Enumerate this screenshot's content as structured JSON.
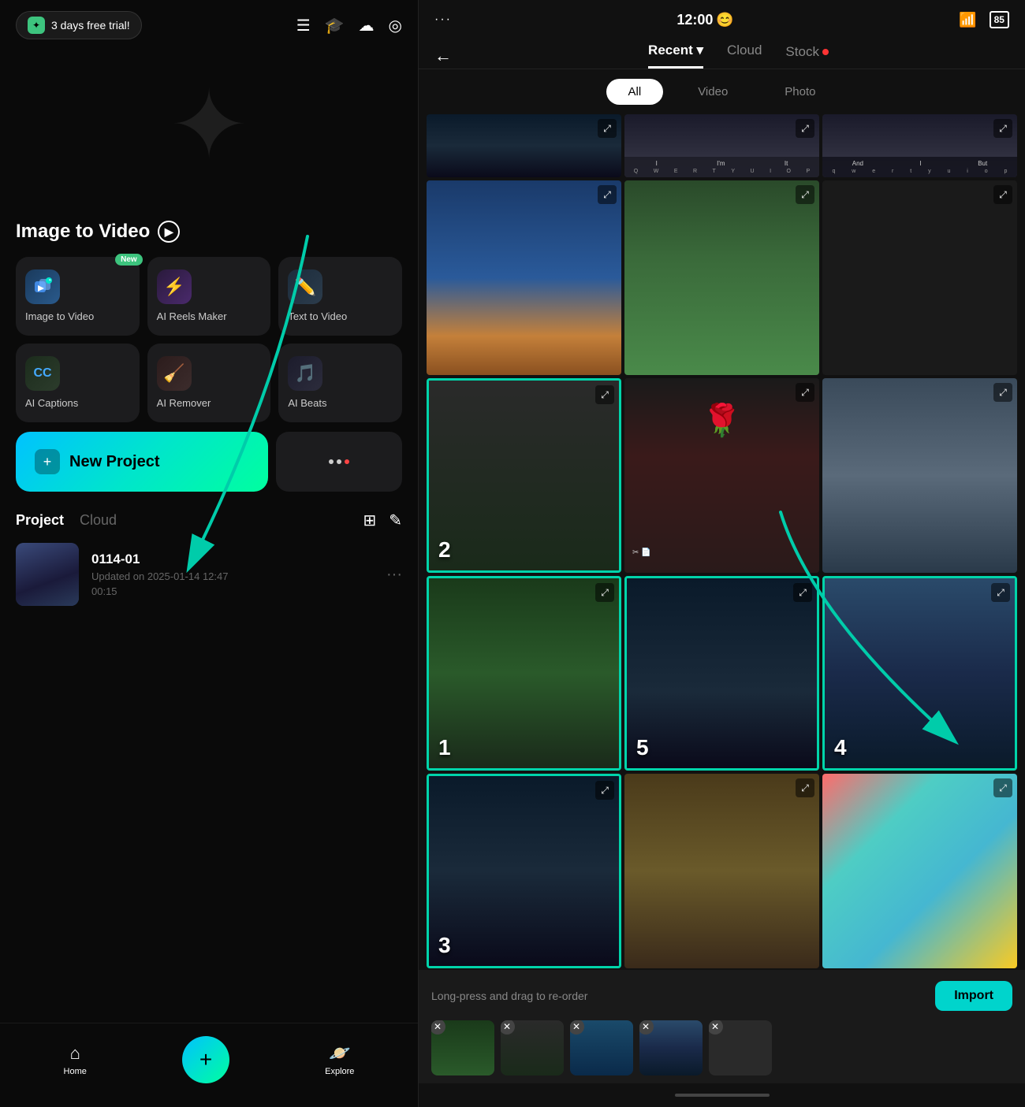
{
  "status": {
    "time": "12:00",
    "emoji": "😊",
    "battery": "85",
    "wifi": "WiFi"
  },
  "left": {
    "trial_badge": "3 days free trial!",
    "itv_title": "Image to Video",
    "features": [
      {
        "id": "image-to-video",
        "label": "Image to Video",
        "icon": "🎬",
        "iconBg": "icon-itv",
        "isNew": true
      },
      {
        "id": "ai-reels",
        "label": "AI Reels Maker",
        "icon": "⚡",
        "iconBg": "icon-reels",
        "isNew": false
      },
      {
        "id": "text-to-video",
        "label": "Text  to Video",
        "icon": "✏️",
        "iconBg": "icon-ttv",
        "isNew": false
      },
      {
        "id": "ai-captions",
        "label": "AI Captions",
        "icon": "CC",
        "iconBg": "icon-captions",
        "isNew": false
      },
      {
        "id": "ai-remover",
        "label": "AI Remover",
        "icon": "🧹",
        "iconBg": "icon-remover",
        "isNew": false
      },
      {
        "id": "ai-beats",
        "label": "AI Beats",
        "icon": "🎵",
        "iconBg": "icon-beats",
        "isNew": false
      }
    ],
    "new_project_label": "+ New Project",
    "new_project_btn": "New Project",
    "project_tab": "Project",
    "cloud_tab": "Cloud",
    "project_name": "0114-01",
    "project_date": "Updated on 2025-01-14 12:47",
    "project_duration": "00:15",
    "nav": {
      "home": "Home",
      "explore": "Explore"
    }
  },
  "right": {
    "back": "←",
    "tabs": [
      "Recent",
      "Cloud",
      "Stock"
    ],
    "active_tab": "Recent",
    "dropdown_arrow": "▾",
    "filter_tabs": [
      "All",
      "Video",
      "Photo"
    ],
    "active_filter": "All",
    "media_cells": [
      {
        "id": "c1",
        "bg": "bg-keyboard",
        "selected": false,
        "number": null
      },
      {
        "id": "c2",
        "bg": "bg-tree",
        "selected": false,
        "number": null
      },
      {
        "id": "c3",
        "bg": "bg-dark",
        "selected": false,
        "number": null
      },
      {
        "id": "c4",
        "bg": "bg-laptop",
        "selected": false,
        "number": null
      },
      {
        "id": "c5",
        "bg": "bg-food",
        "selected": false,
        "number": null
      },
      {
        "id": "c6",
        "bg": "bg-dark2",
        "selected": false,
        "number": null
      },
      {
        "id": "c7",
        "bg": "bg-dark2",
        "selected": true,
        "number": "2"
      },
      {
        "id": "c8",
        "bg": "bg-rose",
        "selected": false,
        "number": null
      },
      {
        "id": "c9",
        "bg": "bg-window",
        "selected": false,
        "number": null
      },
      {
        "id": "c10",
        "bg": "bg-landscape",
        "selected": true,
        "number": "1"
      },
      {
        "id": "c11",
        "bg": "bg-night",
        "selected": true,
        "number": "5"
      },
      {
        "id": "c12",
        "bg": "bg-mountain",
        "selected": true,
        "number": "4"
      },
      {
        "id": "c13",
        "bg": "bg-street",
        "selected": true,
        "number": "3"
      },
      {
        "id": "c14",
        "bg": "bg-pizza",
        "selected": false,
        "number": null
      },
      {
        "id": "c15",
        "bg": "bg-colorful",
        "selected": false,
        "number": null
      }
    ],
    "import_hint": "Long-press and drag to re-order",
    "import_btn": "Import",
    "strip_items": [
      {
        "id": "s1",
        "bg": "bg-landscape"
      },
      {
        "id": "s2",
        "bg": "bg-dark2"
      },
      {
        "id": "s3",
        "bg": "bg-mountain"
      },
      {
        "id": "s4",
        "bg": "bg-night"
      },
      {
        "id": "s5",
        "bg": "bg-dark"
      }
    ]
  }
}
